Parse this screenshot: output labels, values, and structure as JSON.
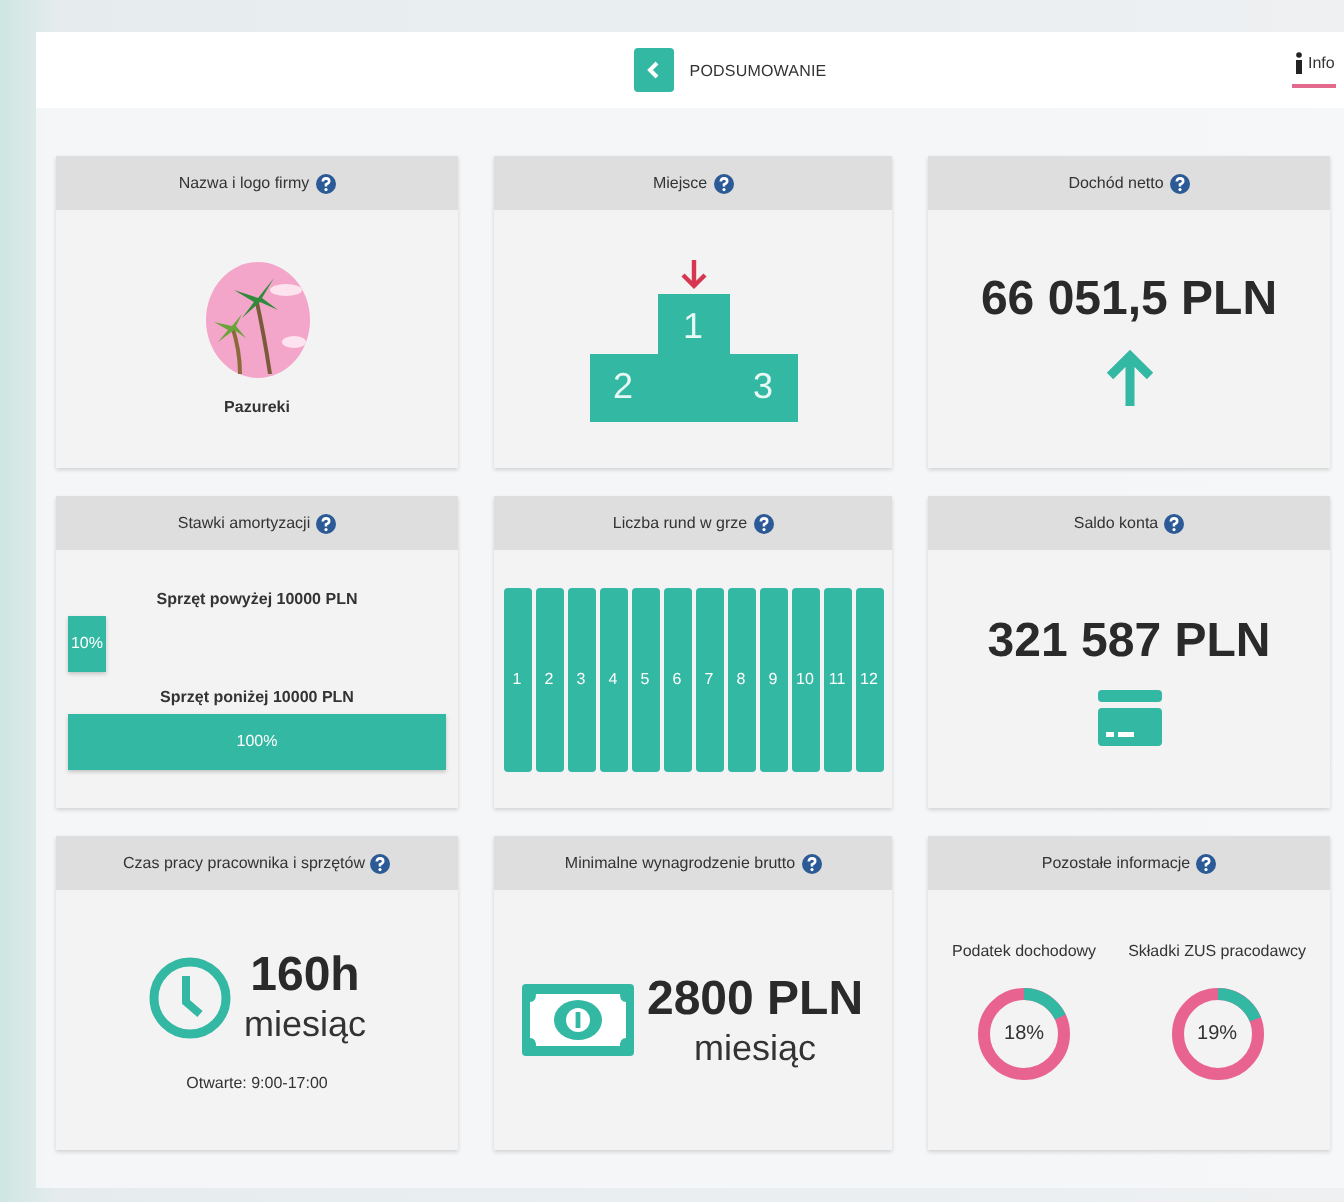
{
  "header": {
    "title": "PODSUMOWANIE",
    "info_tab": {
      "label": "Info",
      "selected": true
    }
  },
  "cards": [
    {
      "kind": "logo",
      "title": "Nazwa i logo firmy",
      "name": "Pazureki"
    },
    {
      "kind": "podium",
      "title": "Miejsce",
      "places": [
        "1",
        "2",
        "3"
      ]
    },
    {
      "kind": "income",
      "title": "Dochód netto",
      "value": "66 051,5 PLN"
    },
    {
      "kind": "depreciation",
      "title": "Stawki amortyzacji",
      "rates": [
        {
          "label": "Sprzęt powyżej 10000 PLN",
          "reading": "10%",
          "level": 0.1
        },
        {
          "label": "Sprzęt poniżej 10000 PLN",
          "reading": "100%",
          "level": 1
        }
      ]
    },
    {
      "kind": "rounds",
      "title": "Liczba rund w grze",
      "rounds": [
        "1",
        "2",
        "3",
        "4",
        "5",
        "6",
        "7",
        "8",
        "9",
        "10",
        "11",
        "12"
      ]
    },
    {
      "kind": "balance",
      "title": "Saldo konta",
      "value": "321 587 PLN"
    },
    {
      "kind": "hours",
      "title": "Czas pracy pracownika i sprzętów",
      "value": "160h",
      "unit": "miesiąc",
      "note": "Otwarte: 9:00-17:00"
    },
    {
      "kind": "wage",
      "title": "Minimalne wynagrodzenie brutto",
      "value": "2800 PLN",
      "unit": "miesiąc"
    },
    {
      "kind": "other",
      "title": "Pozostałe informacje",
      "items": [
        {
          "label": "Podatek dochodowy",
          "reading": "18%",
          "level": 0.18
        },
        {
          "label": "Składki ZUS pracodawcy",
          "reading": "19%",
          "level": 0.19
        }
      ]
    }
  ]
}
